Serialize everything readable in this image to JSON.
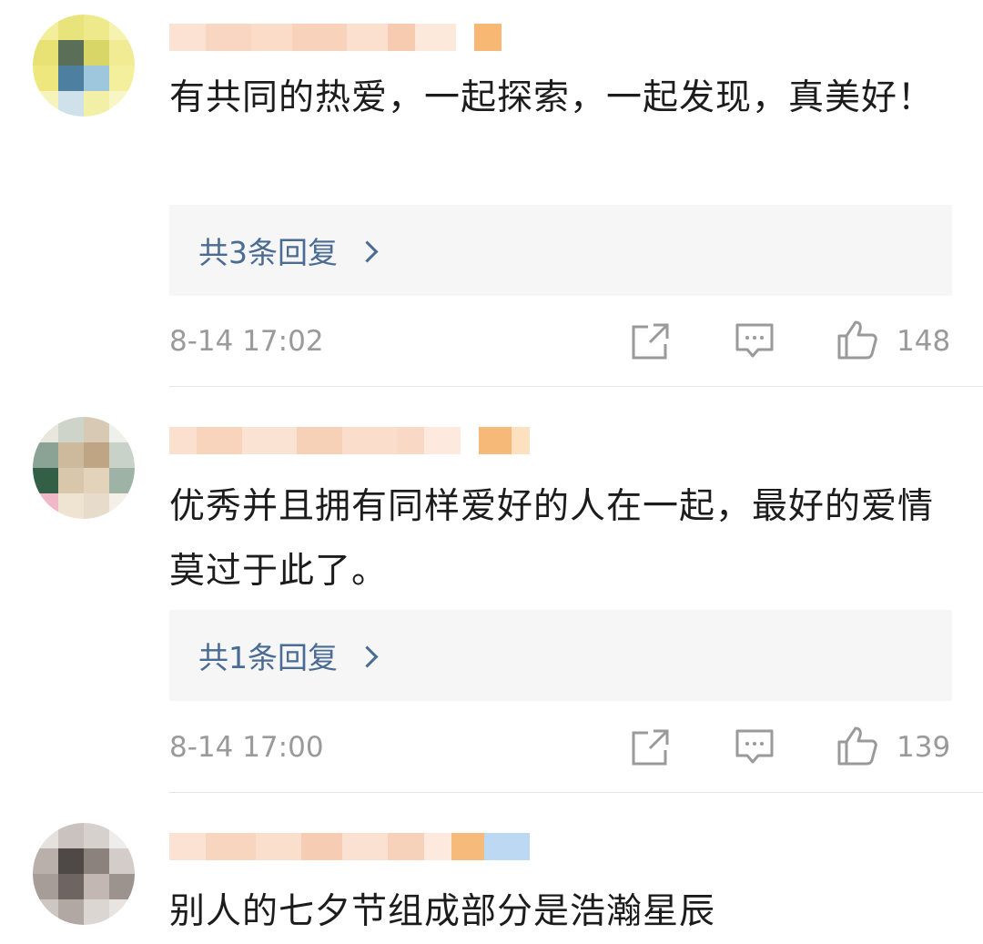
{
  "comments": [
    {
      "text": "有共同的热爱，一起探索，一起发现，真美好！",
      "reply_label": "共3条回复",
      "time": "8-14 17:02",
      "likes": "148"
    },
    {
      "text": "优秀并且拥有同样爱好的人在一起，最好的爱情莫过于此了。",
      "reply_label": "共1条回复",
      "time": "8-14 17:00",
      "likes": "139"
    },
    {
      "text": "别人的七夕节组成部分是浩瀚星辰"
    }
  ],
  "icons": {
    "share": "share-icon",
    "comment": "comment-icon",
    "like": "like-icon"
  },
  "colors": {
    "link": "#4a6b93",
    "meta": "#9a9a9a",
    "reply_bg": "#f6f6f6"
  }
}
